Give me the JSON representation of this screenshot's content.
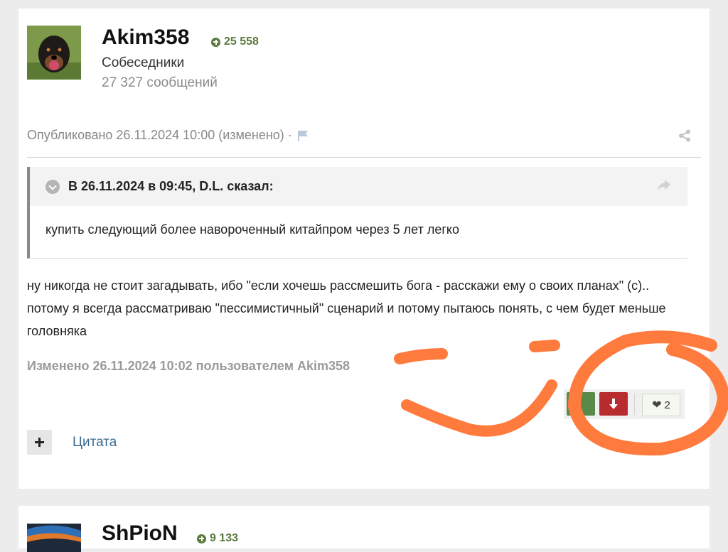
{
  "post1": {
    "username": "Akim358",
    "reputation": "25 558",
    "group": "Собеседники",
    "post_count": "27 327 сообщений",
    "published": "Опубликовано 26.11.2024 10:00 (изменено) ·",
    "quote": {
      "author_line": "В 26.11.2024 в 09:45, D.L. сказал:",
      "text": "купить следующий более навороченный китайпром через 5 лет легко"
    },
    "body": "ну никогда не стоит загадывать, ибо \"если хочешь рассмешить бога - расскажи ему о своих планах\" (с).. потому я всегда рассматриваю \"пессимистичный\" сценарий и потому пытаюсь понять, с чем будет меньше головняка",
    "edited_note": "Изменено 26.11.2024 10:02 пользователем Akim358",
    "likes_count": "2",
    "quote_action": "Цитата"
  },
  "post2": {
    "username": "ShPioN",
    "reputation": "9 133"
  },
  "colors": {
    "reputation_green": "#5b7a3f",
    "upvote_green": "#5a8a4a",
    "downvote_red": "#b82b2f",
    "link_blue": "#3a6a90",
    "annotation_orange": "#ff7a3d"
  },
  "icons": {
    "reputation": "plus-circle-icon",
    "report": "flag-icon",
    "share": "share-icon",
    "quote_toggle": "chevron-down-icon",
    "quote_reply": "reply-arrow-icon",
    "downvote": "arrow-down-icon",
    "like": "heart-icon",
    "multiquote": "plus-icon"
  }
}
